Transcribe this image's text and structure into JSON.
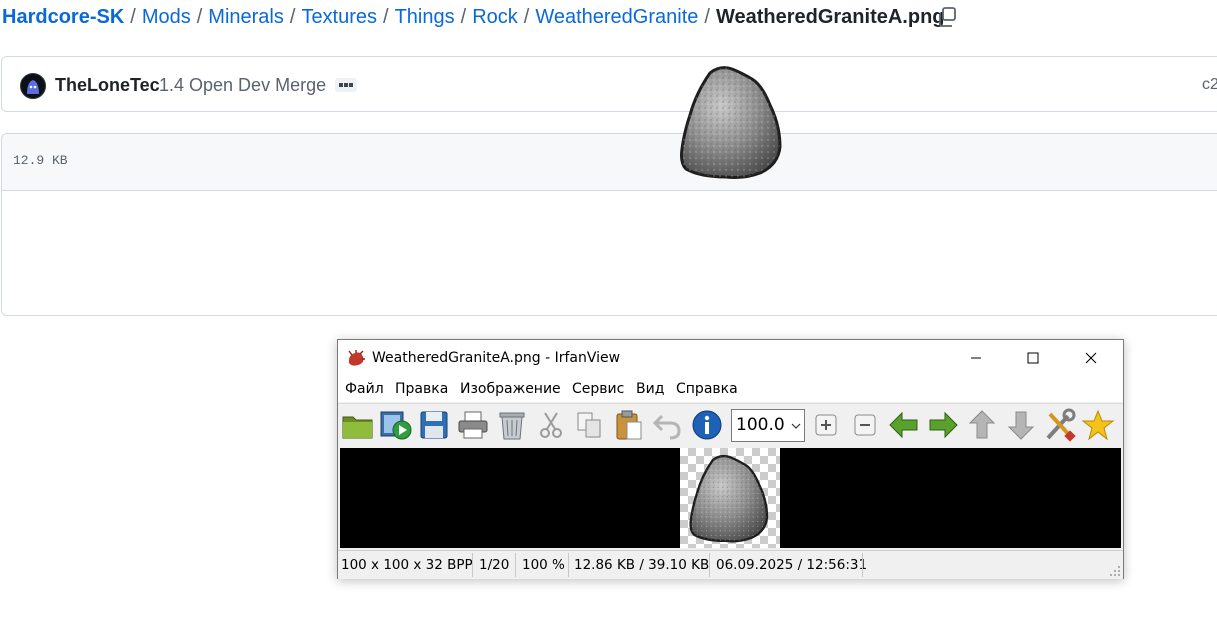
{
  "breadcrumb": {
    "parts": [
      "Hardcore-SK",
      "Mods",
      "Minerals",
      "Textures",
      "Things",
      "Rock",
      "WeatheredGranite"
    ],
    "separator": "/",
    "file": "WeatheredGraniteA.png"
  },
  "commit": {
    "author": "TheLoneTec",
    "message": "1.4 Open Dev Merge",
    "hash_fragment": "c2"
  },
  "file": {
    "size": "12.9 KB"
  },
  "irfanview": {
    "title": "WeatheredGraniteA.png - IrfanView",
    "menu": [
      "Файл",
      "Правка",
      "Изображение",
      "Сервис",
      "Вид",
      "Справка"
    ],
    "zoom_value": "100.0",
    "status": [
      "100 x 100 x 32 BPP",
      "1/20",
      "100 %",
      "12.86 KB / 39.10 KB",
      "06.09.2025 / 12:56:31"
    ],
    "toolbar_icons": [
      "open-folder-icon",
      "slideshow-icon",
      "save-icon",
      "print-icon",
      "delete-icon",
      "cut-icon",
      "copy-icon",
      "paste-icon",
      "undo-icon",
      "info-icon",
      "zoom-in-icon",
      "zoom-out-icon",
      "previous-icon",
      "next-icon",
      "first-icon",
      "last-icon",
      "settings-icon",
      "favorites-icon"
    ]
  },
  "colors": {
    "link": "#0969da",
    "muted": "#59636e",
    "border": "#d1d9e0",
    "panel_bg": "#f6f8fa",
    "window_bg": "#f0f0f0"
  }
}
